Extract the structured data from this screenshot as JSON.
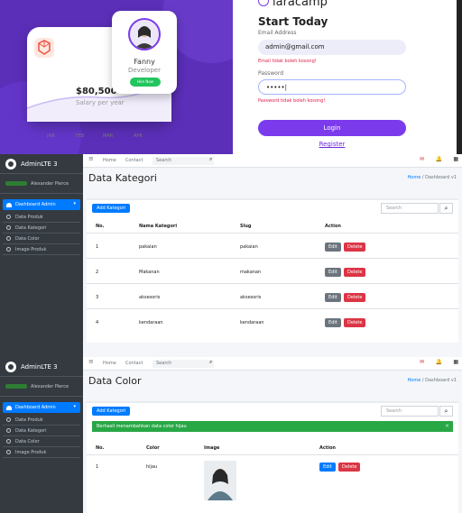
{
  "login": {
    "brand": "laracamp",
    "title": "Start Today",
    "email_label": "Email Address",
    "email_value": "admin@gmail.com",
    "email_error": "Email tidak boleh kosong!",
    "password_label": "Password",
    "password_value": "•••••|",
    "password_error": "Password tidak boleh kosong!",
    "login_button": "Login",
    "register_link": "Register",
    "profile_name": "Fanny",
    "profile_role": "Developer",
    "hire_button": "Hire Now",
    "salary": "$80,500",
    "salary_sub": "Salary per year",
    "months": [
      "JAN",
      "FEB",
      "MAR",
      "APR"
    ]
  },
  "admin": {
    "brand": "AdminLTE 3",
    "user_name": "Alexander Pierce",
    "menu_active": "Dashboard Admin",
    "menu_items": [
      "Data Produk",
      "Data Kategori",
      "Data Color",
      "Image Produk"
    ],
    "nav": {
      "home": "Home",
      "contact": "Contact",
      "search_placeholder": "Search"
    },
    "search_placeholder": "Search",
    "breadcrumb_home": "Home",
    "breadcrumb_sep": "/",
    "breadcrumb_current": "Dashboard v1",
    "btn_edit": "Edit",
    "btn_delete": "Delete"
  },
  "kategori": {
    "title": "Data Kategori",
    "add_button": "Add Kategori",
    "columns": [
      "No.",
      "Nama Kategori",
      "Slug",
      "Action"
    ],
    "rows": [
      [
        "1",
        "pakaian",
        "pakaian"
      ],
      [
        "2",
        "Makanan",
        "makanan"
      ],
      [
        "3",
        "aksesoris",
        "aksesoris"
      ],
      [
        "4",
        "kendaraan",
        "kendaraan"
      ]
    ]
  },
  "color": {
    "title": "Data Color",
    "add_button": "Add Kategori",
    "alert": "Berhasil menambahkan data color hijau",
    "alert_close": "×",
    "columns": [
      "No.",
      "Color",
      "Image",
      "Action"
    ],
    "rows": [
      [
        "1",
        "hijau"
      ]
    ]
  },
  "colors": {
    "purple": "#5b2fb8",
    "accent": "#7c3aed",
    "primary": "#007bff",
    "danger": "#dc3545",
    "success": "#28a745",
    "sidebar": "#343a40"
  }
}
